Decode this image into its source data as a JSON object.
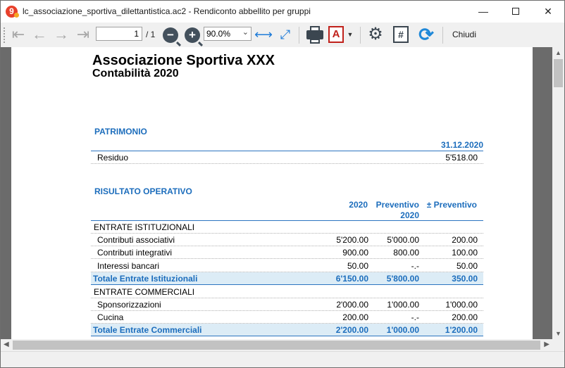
{
  "window": {
    "title": "lc_associazione_sportiva_dilettantistica.ac2 - Rendiconto abbellito per gruppi",
    "app_icon_glyph": "9",
    "minimize_glyph": "—",
    "close_glyph": "✕"
  },
  "toolbar": {
    "first_glyph": "⇤",
    "prev_glyph": "←",
    "next_glyph": "→",
    "last_glyph": "⇥",
    "page_value": "1",
    "page_total": "/ 1",
    "zoom_out_glyph": "−",
    "zoom_in_glyph": "+",
    "zoom_value": "90.0%",
    "fit_width_glyph": "⟷",
    "fit_page_glyph": "⤢",
    "pdf_glyph": "A",
    "pdf_drop_glyph": "▼",
    "gear_glyph": "⚙",
    "hash_glyph": "#",
    "refresh_glyph": "⟳",
    "close_label": "Chiudi"
  },
  "document": {
    "title": "Associazione Sportiva XXX",
    "subtitle": "Contabilità 2020",
    "patrimonio": {
      "heading": "PATRIMONIO",
      "date_header": "31.12.2020",
      "rows": [
        {
          "label": "Residuo",
          "value": "5'518.00"
        }
      ]
    },
    "risultato": {
      "heading": "RISULTATO OPERATIVO",
      "col1": "2020",
      "col2_line1": "Preventivo",
      "col2_line2": "2020",
      "col3": "± Preventivo",
      "groups": [
        {
          "name": "ENTRATE ISTITUZIONALI",
          "rows": [
            {
              "label": "Contributi associativi",
              "v2020": "5'200.00",
              "prev": "5'000.00",
              "diff": "200.00"
            },
            {
              "label": "Contributi integrativi",
              "v2020": "900.00",
              "prev": "800.00",
              "diff": "100.00"
            },
            {
              "label": "Interessi bancari",
              "v2020": "50.00",
              "prev": "-.-",
              "diff": "50.00"
            }
          ],
          "total": {
            "label": "Totale Entrate Istituzionali",
            "v2020": "6'150.00",
            "prev": "5'800.00",
            "diff": "350.00"
          }
        },
        {
          "name": "ENTRATE COMMERCIALI",
          "rows": [
            {
              "label": "Sponsorizzazioni",
              "v2020": "2'000.00",
              "prev": "1'000.00",
              "diff": "1'000.00"
            },
            {
              "label": "Cucina",
              "v2020": "200.00",
              "prev": "-.-",
              "diff": "200.00"
            }
          ],
          "total": {
            "label": "Totale Entrate Commerciali",
            "v2020": "2'200.00",
            "prev": "1'000.00",
            "diff": "1'200.00"
          }
        }
      ]
    }
  },
  "scrollbars": {
    "up_glyph": "▲",
    "down_glyph": "▼",
    "left_glyph": "◀",
    "right_glyph": "▶"
  },
  "colors": {
    "accent_blue": "#1c6dbc",
    "total_row_bg": "#dcecf6",
    "app_icon_red": "#e8402b"
  }
}
